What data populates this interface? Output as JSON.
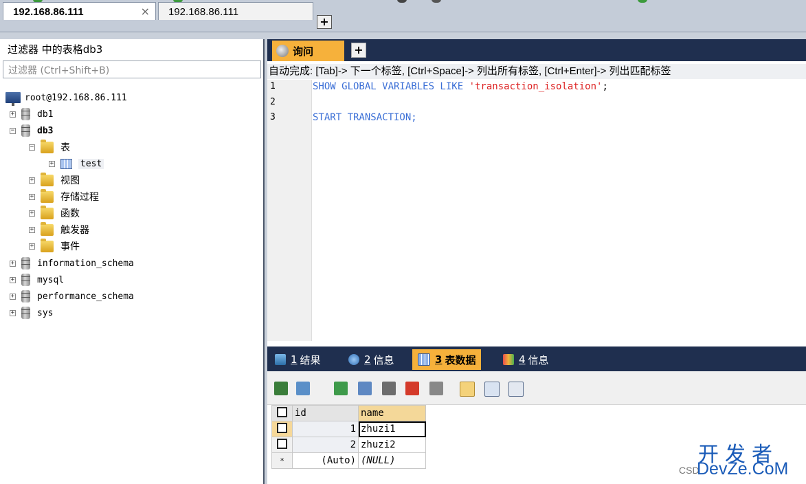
{
  "connection_tabs": [
    {
      "label": "192.168.86.111",
      "active": true,
      "close": "×"
    },
    {
      "label": "192.168.86.111",
      "active": false
    }
  ],
  "new_tab_symbol": "+",
  "object_browser": {
    "title": "过滤器 中的表格db3",
    "filter_placeholder": "过滤器 (Ctrl+Shift+B)",
    "server": "root@192.168.86.111",
    "db1": "db1",
    "db3": "db3",
    "folder_tables": "表",
    "table_test": "test",
    "folder_views": "视图",
    "folder_procs": "存储过程",
    "folder_funcs": "函数",
    "folder_triggers": "触发器",
    "folder_events": "事件",
    "db_info": "information_schema",
    "db_mysql": "mysql",
    "db_perf": "performance_schema",
    "db_sys": "sys",
    "expand": "+",
    "collapse": "−"
  },
  "query": {
    "tab_label": "询问",
    "autocomplete_hint": "自动完成: [Tab]-> 下一个标签, [Ctrl+Space]-> 列出所有标签, [Ctrl+Enter]-> 列出匹配标签",
    "line_numbers": [
      "1",
      "2",
      "3"
    ],
    "line1_kw": "SHOW GLOBAL VARIABLES LIKE ",
    "line1_str": "'transaction_isolation'",
    "line1_end": ";",
    "line3": "START TRANSACTION;"
  },
  "results_tabs": [
    {
      "num": "1",
      "label": "结果"
    },
    {
      "num": "2",
      "label": "信息"
    },
    {
      "num": "3",
      "label": "表数据"
    },
    {
      "num": "4",
      "label": "信息"
    }
  ],
  "grid": {
    "columns": [
      "id",
      "name"
    ],
    "rows": [
      {
        "id": "1",
        "name": "zhuzi1"
      },
      {
        "id": "2",
        "name": "zhuzi2"
      },
      {
        "id": "(Auto)",
        "name": "(NULL)"
      }
    ],
    "new_row_marker": "*"
  },
  "watermark": {
    "cn": "开发者",
    "en": "DevZe.CoM",
    "prefix": "CSD"
  }
}
